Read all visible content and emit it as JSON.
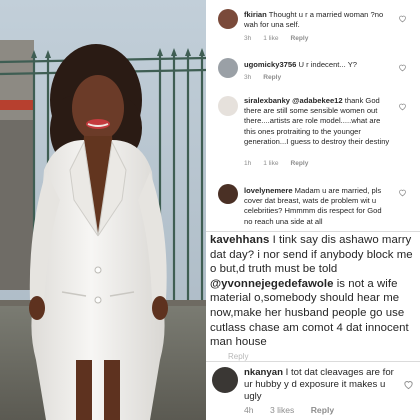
{
  "comments": [
    {
      "username": "fkirian",
      "text": "Thought u r a married woman ?no wah for una self.",
      "time": "3h",
      "likes": "1 like",
      "reply": "Reply"
    },
    {
      "username": "ugomicky3756",
      "text": "U r indecent... Y?",
      "time": "3h",
      "likes": "",
      "reply": "Reply"
    },
    {
      "username": "siralexbanky",
      "mention": "@adabekee12",
      "text": "thank God there are still some sensible women out there....artists are role model.....what are this ones protraiting to the younger generation...I guess to destroy their destiny",
      "time": "1h",
      "likes": "1 like",
      "reply": "Reply"
    },
    {
      "username": "lovelynemere",
      "text": "Madam u are married, pls cover dat breast, wats de problem wit u celebrities? Hmmmm dis respect for God no reach una side at all",
      "time": "",
      "likes": "",
      "reply": ""
    },
    {
      "username": "kavehhans",
      "text_before": "I tink say dis ashawo marry dat day? i nor send if anybody block me o but,d truth must be  told",
      "mention": "@yvonnejegedefawole",
      "text_after": "is not a wife material o,somebody should hear me now,make her husband people go use cutlass chase am comot 4 dat innocent man house",
      "partial_meta": "Reply"
    },
    {
      "username": "nkanyan",
      "text": "I tot dat cleavages are for ur hubby y d exposure it makes u ugly",
      "time": "4h",
      "likes": "3 likes",
      "reply": "Reply"
    }
  ],
  "colors": {
    "text": "#262626",
    "meta": "#8e8e8e",
    "heart": "#8e8e8e",
    "jacket": "#f4f3f1"
  },
  "icons": [
    "heart-outline-icon"
  ]
}
